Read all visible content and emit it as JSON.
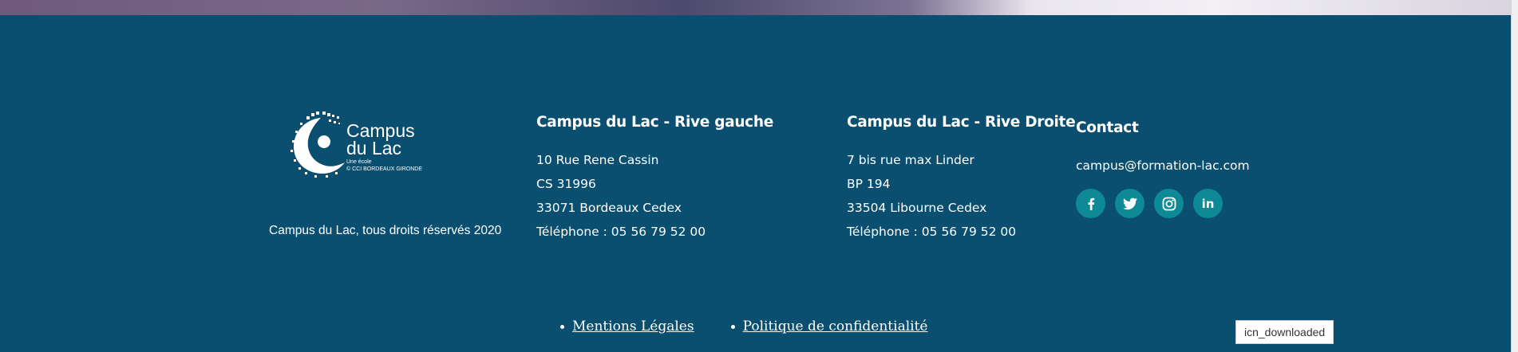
{
  "colors": {
    "footer_bg": "#0a4f70",
    "social_bg": "#0e8a96",
    "text": "#ffffff"
  },
  "logo": {
    "line1": "Campus",
    "line2": "du Lac",
    "tag1": "Une école",
    "tag2": "© CCI BORDEAUX GIRONDE"
  },
  "copyright": "Campus du Lac, tous droits réservés 2020",
  "rive_gauche": {
    "title": "Campus du Lac - Rive gauche",
    "lines": [
      "10 Rue Rene Cassin",
      "CS 31996",
      "33071 Bordeaux Cedex",
      "Téléphone : 05 56 79 52 00"
    ]
  },
  "rive_droite": {
    "title": "Campus du Lac - Rive Droite",
    "lines": [
      "7 bis rue max Linder",
      "BP 194",
      "33504 Libourne Cedex",
      "Téléphone : 05 56 79 52 00"
    ]
  },
  "contact": {
    "title": "Contact",
    "email": "campus@formation-lac.com",
    "socials": [
      {
        "icon": "facebook-icon",
        "glyph": "f"
      },
      {
        "icon": "twitter-icon",
        "glyph": ""
      },
      {
        "icon": "instagram-icon",
        "glyph": ""
      },
      {
        "icon": "linkedin-icon",
        "glyph": "in"
      }
    ]
  },
  "legal_links": [
    "Mentions Légales",
    "Politique de confidentialité"
  ],
  "tooltip": "icn_downloaded"
}
